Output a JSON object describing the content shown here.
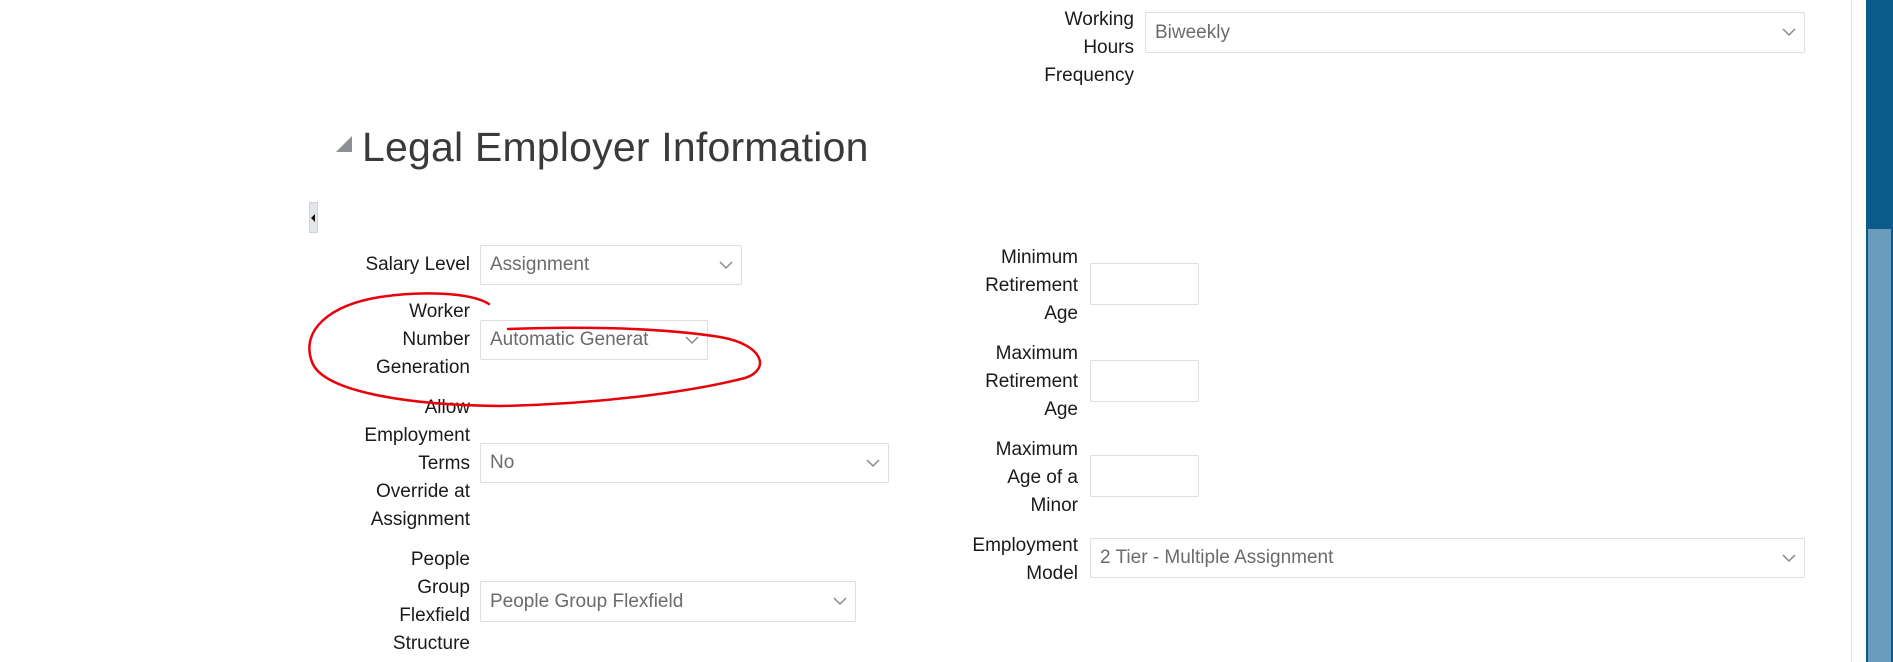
{
  "top_field": {
    "label": "Working Hours Frequency",
    "label_lines": [
      "Working",
      "Hours",
      "Frequency"
    ],
    "value": "Biweekly"
  },
  "section": {
    "title": "Legal Employer Information"
  },
  "left_fields": [
    {
      "label_lines": [
        "Salary Level"
      ],
      "value": "Assignment"
    },
    {
      "label_lines": [
        "Worker",
        "Number",
        "Generation"
      ],
      "value": "Automatic Generat"
    },
    {
      "label_lines": [
        "Allow",
        "Employment",
        "Terms",
        "Override at",
        "Assignment"
      ],
      "value": "No"
    },
    {
      "label_lines": [
        "People",
        "Group",
        "Flexfield",
        "Structure"
      ],
      "value": "People Group Flexfield"
    }
  ],
  "right_fields": [
    {
      "label_lines": [
        "Minimum",
        "Retirement",
        "Age"
      ],
      "value": ""
    },
    {
      "label_lines": [
        "Maximum",
        "Retirement",
        "Age"
      ],
      "value": ""
    },
    {
      "label_lines": [
        "Maximum",
        "Age of a",
        "Minor"
      ],
      "value": ""
    },
    {
      "label_lines": [
        "Employment",
        "Model"
      ],
      "value": "2 Tier - Multiple Assignment"
    }
  ],
  "colors": {
    "annotation": "#e8000b",
    "scrollbar_track": "#0b5a8c",
    "scrollbar_thumb": "#6a9cbd"
  }
}
